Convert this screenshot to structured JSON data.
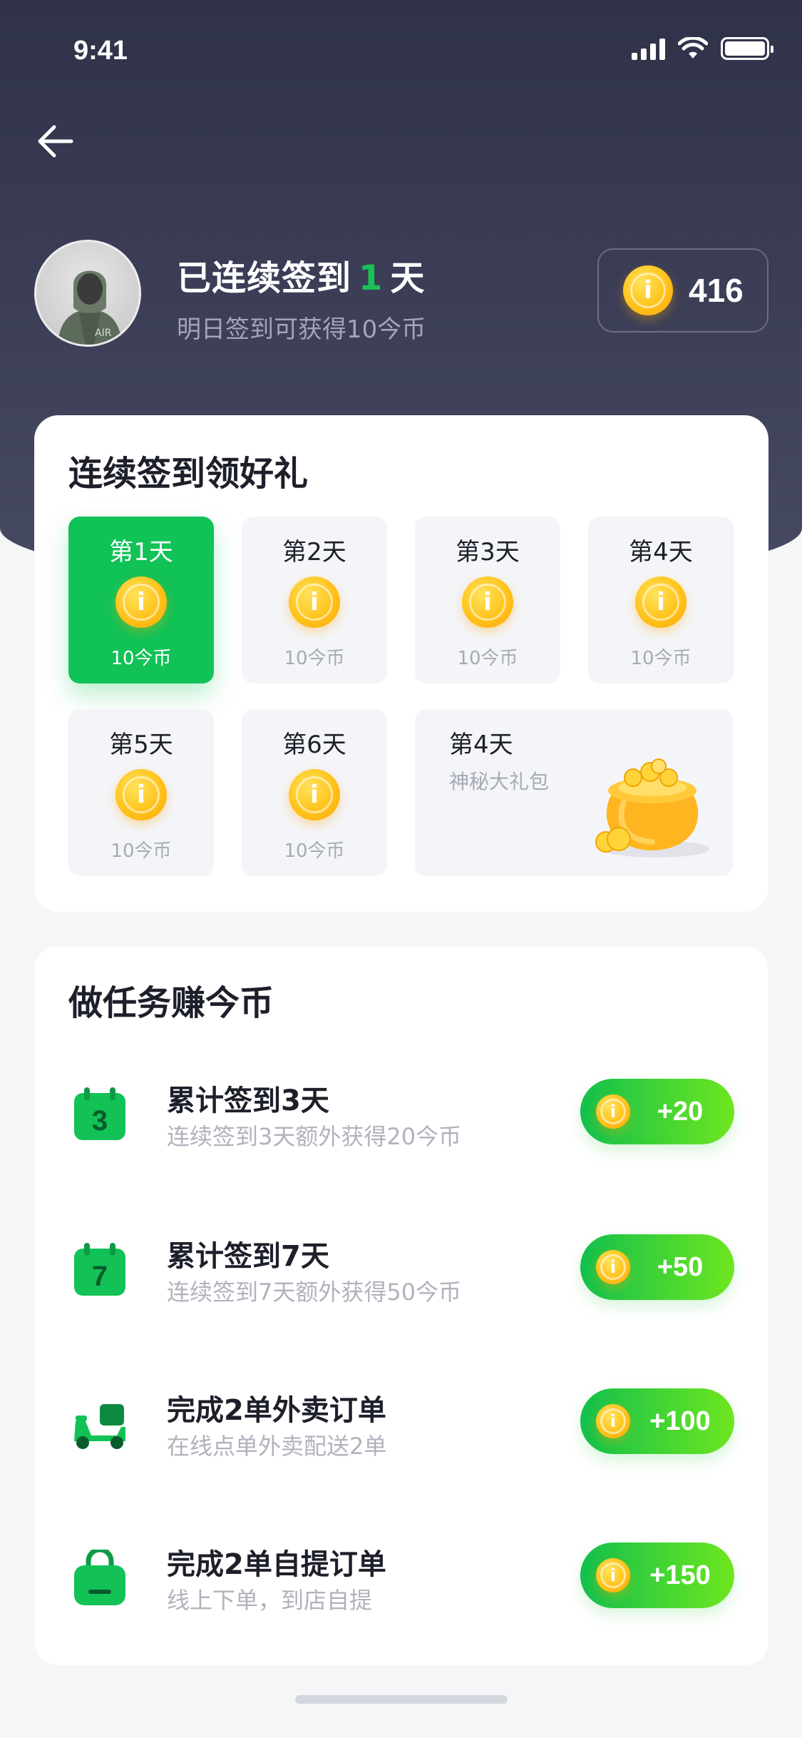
{
  "status_bar": {
    "time": "9:41"
  },
  "header": {
    "streak_prefix": "已连续签到",
    "streak_days": "1",
    "streak_suffix": "天",
    "subtitle": "明日签到可获得10今币",
    "coin_balance": "416"
  },
  "checkin": {
    "title": "连续签到领好礼",
    "days": [
      {
        "label": "第1天",
        "reward": "10今币",
        "active": true
      },
      {
        "label": "第2天",
        "reward": "10今币",
        "active": false
      },
      {
        "label": "第3天",
        "reward": "10今币",
        "active": false
      },
      {
        "label": "第4天",
        "reward": "10今币",
        "active": false
      },
      {
        "label": "第5天",
        "reward": "10今币",
        "active": false
      },
      {
        "label": "第6天",
        "reward": "10今币",
        "active": false
      }
    ],
    "gift": {
      "label": "第4天",
      "subtitle": "神秘大礼包"
    }
  },
  "tasks": {
    "title": "做任务赚今币",
    "items": [
      {
        "icon": "calendar-3-icon",
        "title": "累计签到3天",
        "subtitle": "连续签到3天额外获得20今币",
        "reward": "+20"
      },
      {
        "icon": "calendar-7-icon",
        "title": "累计签到7天",
        "subtitle": "连续签到7天额外获得50今币",
        "reward": "+50"
      },
      {
        "icon": "scooter-icon",
        "title": "完成2单外卖订单",
        "subtitle": "在线点单外卖配送2单",
        "reward": "+100"
      },
      {
        "icon": "shopping-bag-icon",
        "title": "完成2单自提订单",
        "subtitle": "线上下单，到店自提",
        "reward": "+150"
      }
    ]
  },
  "colors": {
    "accent_green": "#11c257",
    "header_dark": "#2f3249",
    "coin_gold": "#ffc21a"
  }
}
